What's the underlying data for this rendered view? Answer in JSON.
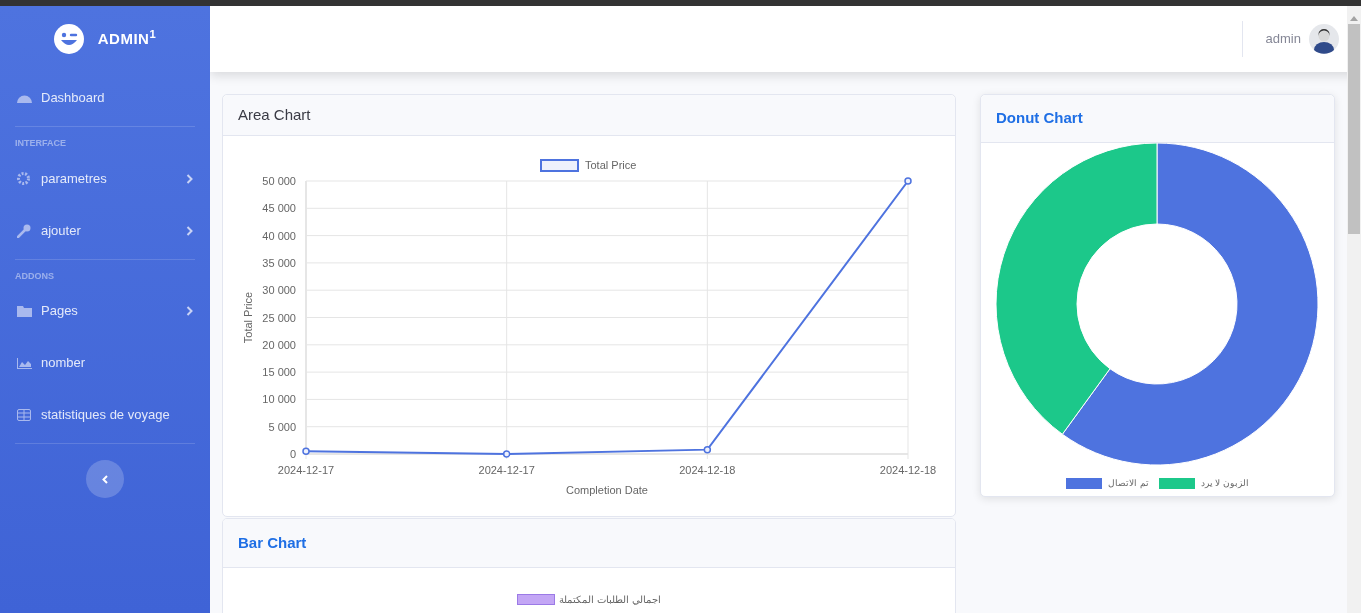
{
  "sidebar": {
    "brand": "ADMIN",
    "brand_sup": "1",
    "items": [
      {
        "kind": "link",
        "label": "Dashboard",
        "expandable": false
      },
      {
        "kind": "divider"
      },
      {
        "kind": "heading",
        "label": "INTERFACE"
      },
      {
        "kind": "link",
        "label": "parametres",
        "expandable": true
      },
      {
        "kind": "link",
        "label": "ajouter",
        "expandable": true
      },
      {
        "kind": "divider"
      },
      {
        "kind": "heading",
        "label": "ADDONS"
      },
      {
        "kind": "link",
        "label": "Pages",
        "expandable": true
      },
      {
        "kind": "link",
        "label": "nomber",
        "expandable": false
      },
      {
        "kind": "link",
        "label": "statistiques de voyage",
        "expandable": false
      },
      {
        "kind": "divider"
      }
    ]
  },
  "topbar": {
    "user": "admin"
  },
  "area_card": {
    "title": "Area Chart",
    "chart_data": {
      "type": "line",
      "xlabel": "Completion Date",
      "ylabel": "Total Price",
      "categories": [
        "2024-12-17",
        "2024-12-17",
        "2024-12-18",
        "2024-12-18"
      ],
      "series": [
        {
          "name": "Total Price",
          "color": "#4e73df",
          "marker": true,
          "values": [
            500,
            0,
            800,
            50000
          ]
        }
      ],
      "grid": true,
      "legend": true,
      "ylim": [
        0,
        50000
      ],
      "yticks": [
        {
          "value": 0,
          "label": "0"
        },
        {
          "value": 5000,
          "label": "5 000"
        },
        {
          "value": 10000,
          "label": "10 000"
        },
        {
          "value": 15000,
          "label": "15 000"
        },
        {
          "value": 20000,
          "label": "20 000"
        },
        {
          "value": 25000,
          "label": "25 000"
        },
        {
          "value": 30000,
          "label": "30 000"
        },
        {
          "value": 35000,
          "label": "35 000"
        },
        {
          "value": 40000,
          "label": "40 000"
        },
        {
          "value": 45000,
          "label": "45 000"
        },
        {
          "value": 50000,
          "label": "50 000"
        }
      ]
    }
  },
  "donut_card": {
    "title": "Donut Chart",
    "chart_data": {
      "type": "donut",
      "categories": [
        "تم الاتصال",
        "الزبون لا يرد"
      ],
      "values": [
        60,
        40
      ],
      "colors": [
        "#4e73df",
        "#1cc88a"
      ],
      "legend": true
    }
  },
  "bar_card": {
    "title": "Bar Chart",
    "legend": [
      {
        "label": "اجمالي الطلبات المكتملة",
        "color": "#c3a6f5"
      }
    ]
  }
}
